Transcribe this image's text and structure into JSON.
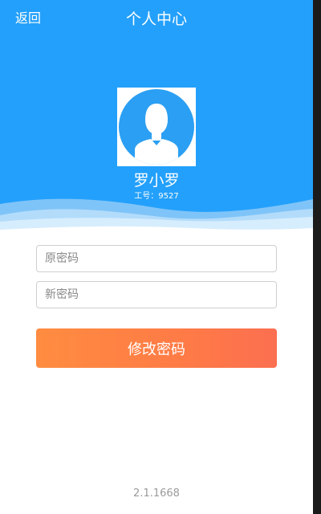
{
  "header": {
    "back_label": "返回",
    "title": "个人中心"
  },
  "profile": {
    "avatar_icon": "user-silhouette-icon",
    "name": "罗小罗",
    "employee_id": "工号：9527"
  },
  "form": {
    "old_password_placeholder": "原密码",
    "new_password_placeholder": "新密码",
    "submit_label": "修改密码"
  },
  "footer": {
    "version": "2.1.1668"
  },
  "colors": {
    "header_blue": "#23a0fb",
    "avatar_blue": "#2b9ff3",
    "button_start": "#ff8c40",
    "button_end": "#fb6f50"
  }
}
